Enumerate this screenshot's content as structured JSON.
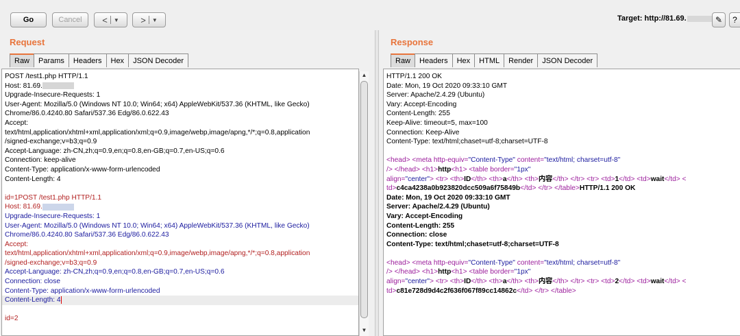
{
  "toolbar": {
    "go_label": "Go",
    "cancel_label": "Cancel",
    "back_label": "<",
    "forward_label": ">",
    "target_label": "Target: http://81.69.",
    "help_label": "?"
  },
  "request": {
    "title": "Request",
    "tabs": [
      "Raw",
      "Params",
      "Headers",
      "Hex",
      "JSON Decoder"
    ],
    "active_tab": "Raw",
    "lines": {
      "l1": "POST /test1.php HTTP/1.1",
      "l2": "Host: 81.69.",
      "l3": "Upgrade-Insecure-Requests: 1",
      "l4": "User-Agent: Mozilla/5.0 (Windows NT 10.0; Win64; x64) AppleWebKit/537.36 (KHTML, like Gecko)",
      "l5": "Chrome/86.0.4240.80 Safari/537.36 Edg/86.0.622.43",
      "l6": "Accept:",
      "l7": "text/html,application/xhtml+xml,application/xml;q=0.9,image/webp,image/apng,*/*;q=0.8,application",
      "l8": "/signed-exchange;v=b3;q=0.9",
      "l9": "Accept-Language: zh-CN,zh;q=0.9,en;q=0.8,en-GB;q=0.7,en-US;q=0.6",
      "l10": "Connection: keep-alive",
      "l11": "Content-Type: application/x-www-form-urlencoded",
      "l12": "Content-Length: 4",
      "l14": "id=1POST /test1.php HTTP/1.1",
      "l15": "Host: 81.69.",
      "l16": "Upgrade-Insecure-Requests: 1",
      "l17": "User-Agent: Mozilla/5.0 (Windows NT 10.0; Win64; x64) AppleWebKit/537.36 (KHTML, like Gecko)",
      "l18": "Chrome/86.0.4240.80 Safari/537.36 Edg/86.0.622.43",
      "l19": "Accept:",
      "l20": "text/html,application/xhtml+xml,application/xml;q=0.9,image/webp,image/apng,*/*;q=0.8,application",
      "l21": "/signed-exchange;v=b3;q=0.9",
      "l22": "Accept-Language: zh-CN,zh;q=0.9,en;q=0.8,en-GB;q=0.7,en-US;q=0.6",
      "l23": "Connection: close",
      "l24": "Content-Type: application/x-www-form-urlencoded",
      "l25": "Content-Length: 4",
      "l27": "id=2"
    }
  },
  "response": {
    "title": "Response",
    "tabs": [
      "Raw",
      "Headers",
      "Hex",
      "HTML",
      "Render",
      "JSON Decoder"
    ],
    "active_tab": "Raw",
    "headers1": [
      "HTTP/1.1 200 OK",
      "Date: Mon, 19 Oct 2020 09:33:10 GMT",
      "Server: Apache/2.4.29 (Ubuntu)",
      "Vary: Accept-Encoding",
      "Content-Length: 255",
      "Keep-Alive: timeout=5, max=100",
      "Connection: Keep-Alive",
      "Content-Type: text/html;chaset=utf-8;charset=UTF-8"
    ],
    "html1": {
      "a1": "<head>",
      "a2": " <meta http-equiv=",
      "a3": "\"Content-Type\"",
      "a4": " content=",
      "a5": "\"text/html; charset=utf-8\"",
      "b1": "/> </head>",
      "b2": " <h1>",
      "b3": "http",
      "b4": "<h1>",
      "b5": " <table border=",
      "b6": "\"1px\"",
      "c1": "align=",
      "c2": "\"center\"",
      "c3": "> <tr> <th>",
      "c4": "ID",
      "c5": "</th> <th>",
      "c6": "a",
      "c7": "</th> <th>",
      "c8": "内容",
      "c9": "</th> </tr> <tr> <td>",
      "c10": "1",
      "c11": "</td> <td>",
      "c12": "wait",
      "c13": "</td> <",
      "d1": "td>",
      "d2": "c4ca4238a0b923820dcc509a6f75849b",
      "d3": "</td> </tr> </table>",
      "d4": "HTTP/1.1 200 OK"
    },
    "headers2": [
      "Date: Mon, 19 Oct 2020 09:33:10 GMT",
      "Server: Apache/2.4.29 (Ubuntu)",
      "Vary: Accept-Encoding",
      "Content-Length: 255",
      "Connection: close",
      "Content-Type: text/html;chaset=utf-8;charset=UTF-8"
    ],
    "html2": {
      "a1": "<head>",
      "a2": " <meta http-equiv=",
      "a3": "\"Content-Type\"",
      "a4": " content=",
      "a5": "\"text/html; charset=utf-8\"",
      "b1": "/> </head>",
      "b2": " <h1>",
      "b3": "http",
      "b4": "<h1>",
      "b5": " <table border=",
      "b6": "\"1px\"",
      "c1": "align=",
      "c2": "\"center\"",
      "c3": "> <tr> <th>",
      "c4": "ID",
      "c5": "</th> <th>",
      "c6": "a",
      "c7": "</th> <th>",
      "c8": "内容",
      "c9": "</th> </tr> <tr> <td>",
      "c10": "2",
      "c11": "</td> <td>",
      "c12": "wait",
      "c13": "</td> <",
      "d1": "td>",
      "d2": "c81e728d9d4c2f636f067f89cc14862c",
      "d3": "</td> </tr> </table>"
    }
  }
}
